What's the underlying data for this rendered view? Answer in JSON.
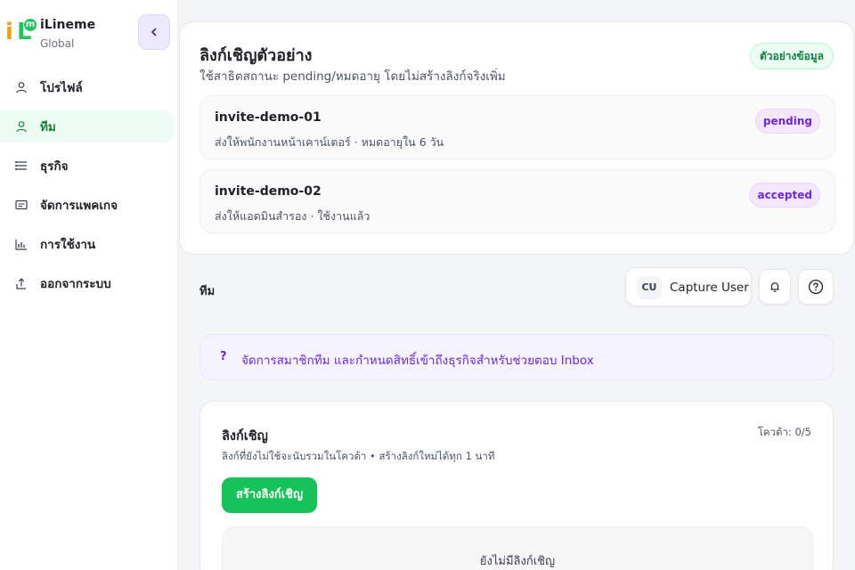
{
  "brand": {
    "name": "iLineme",
    "sub": "Global",
    "logo_i": "i",
    "logo_L": "L",
    "logo_m": "m"
  },
  "sidebar": {
    "items": [
      {
        "label": "โปรไฟล์",
        "icon": "user-icon",
        "active": false
      },
      {
        "label": "ทีม",
        "icon": "user-icon",
        "active": true
      },
      {
        "label": "ธุรกิจ",
        "icon": "list-icon",
        "active": false
      },
      {
        "label": "จัดการแพคเกจ",
        "icon": "card-icon",
        "active": false
      },
      {
        "label": "การใช้งาน",
        "icon": "bar-chart-icon",
        "active": false
      },
      {
        "label": "ออกจากระบบ",
        "icon": "logout-icon",
        "active": false
      }
    ]
  },
  "demo": {
    "title": "ลิงก์เชิญตัวอย่าง",
    "subtitle": "ใช้สาธิตสถานะ pending/หมดอายุ โดยไม่สร้างลิงก์จริงเพิ่ม",
    "badge": "ตัวอย่างข้อมูล",
    "invites": [
      {
        "code": "invite-demo-01",
        "meta": "ส่งให้พนักงานหน้าเคาน์เตอร์ · หมดอายุใน 6 วัน",
        "status": "pending"
      },
      {
        "code": "invite-demo-02",
        "meta": "ส่งให้แอดมินสำรอง · ใช้งานแล้ว",
        "status": "accepted"
      }
    ]
  },
  "header": {
    "page_label": "ทีม",
    "user_initials": "CU",
    "user_name": "Capture User"
  },
  "banner": {
    "icon_text": "?",
    "text": "จัดการสมาชิกทีม และกำหนดสิทธิ์เข้าถึงธุรกิจสำหรับช่วยตอบ Inbox"
  },
  "invite_section": {
    "title": "ลิงก์เชิญ",
    "description": "ลิงก์ที่ยังไม่ใช้จะนับรวมในโควต้า • สร้างลิงก์ใหม่ได้ทุก 1 นาที",
    "quota": "โควต้า: 0/5",
    "create_label": "สร้างลิงก์เชิญ",
    "empty_text": "ยังไม่มีลิงก์เชิญ"
  },
  "colors": {
    "accent_green": "#16c35a",
    "accent_purple": "#6d28d9",
    "active_bg": "#ecfdf3"
  }
}
